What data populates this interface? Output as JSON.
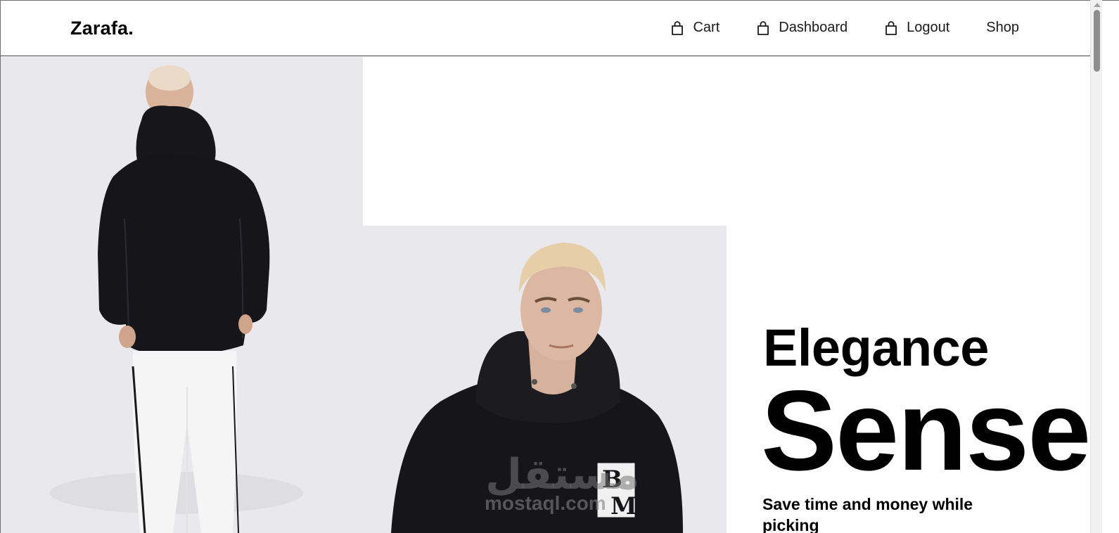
{
  "header": {
    "brand": "Zarafa.",
    "nav": [
      {
        "label": "Cart",
        "icon": "shopping-bag-icon"
      },
      {
        "label": "Dashboard",
        "icon": "shopping-bag-icon"
      },
      {
        "label": "Logout",
        "icon": "shopping-bag-icon"
      },
      {
        "label": "Shop",
        "icon": ""
      }
    ]
  },
  "hero": {
    "line1": "Elegance",
    "line2": "Sense",
    "subtitle": "Save time and money while picking"
  },
  "watermark": {
    "arabic": "مستقل",
    "latin": "mostaql.com"
  },
  "colors": {
    "photo_background": "#e9e8ec",
    "hoodie": "#16161a",
    "pants": "#f4f4f4"
  }
}
